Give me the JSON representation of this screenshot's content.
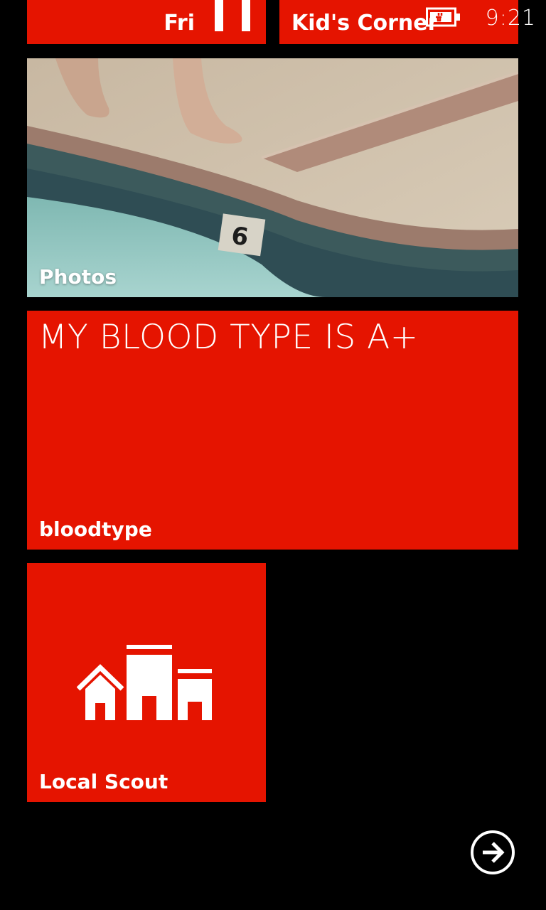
{
  "status_bar": {
    "time": "9:21"
  },
  "tiles": {
    "calendar": {
      "day": "Fri"
    },
    "kids_corner": {
      "label": "Kid's Corner",
      "icon": "battery-charging-icon"
    },
    "photos": {
      "label": "Photos"
    },
    "blood_type": {
      "headline": "MY BLOOD TYPE IS A+",
      "label": "bloodtype"
    },
    "local_scout": {
      "label": "Local Scout",
      "icon": "local-scout-buildings-icon"
    }
  },
  "navigation": {
    "more_icon": "arrow-right-circle-icon"
  },
  "colors": {
    "accent": "#e51400",
    "background": "#000000",
    "text": "#ffffff"
  }
}
